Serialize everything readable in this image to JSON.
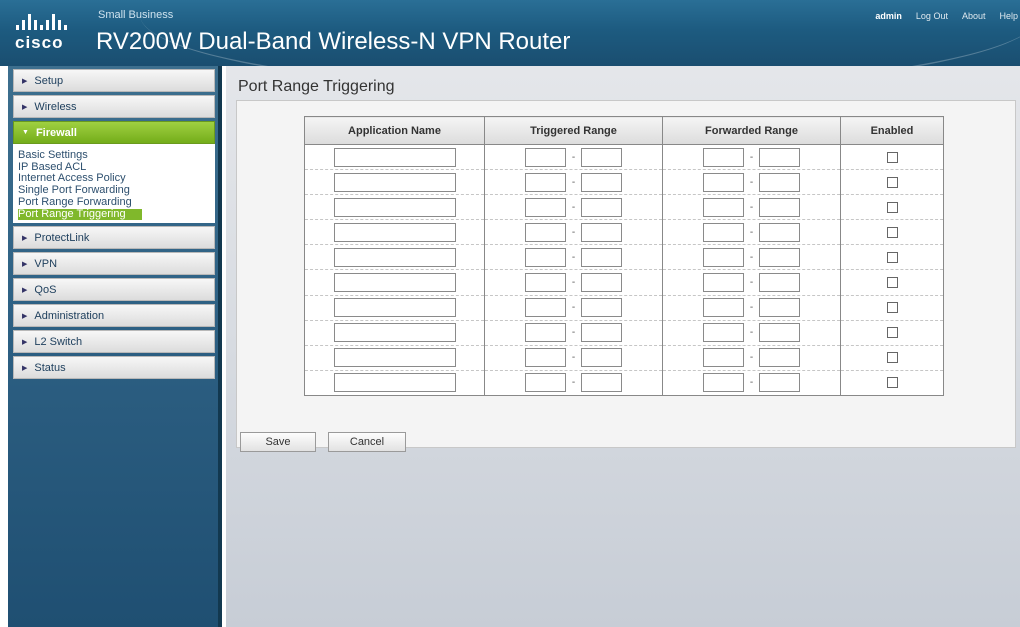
{
  "header": {
    "brand_small": "Small Business",
    "logo_word": "cisco",
    "product": "RV200W Dual-Band Wireless-N VPN Router",
    "links": {
      "user": "admin",
      "logout": "Log Out",
      "about": "About",
      "help": "Help"
    }
  },
  "nav": {
    "setup": "Setup",
    "wireless": "Wireless",
    "firewall": "Firewall",
    "firewall_sub": [
      "Basic Settings",
      "IP Based ACL",
      "Internet Access Policy",
      "Single Port Forwarding",
      "Port Range Forwarding",
      "Port Range Triggering"
    ],
    "protectlink": "ProtectLink",
    "vpn": "VPN",
    "qos": "QoS",
    "administration": "Administration",
    "l2switch": "L2 Switch",
    "status": "Status"
  },
  "page": {
    "title": "Port Range Triggering",
    "columns": {
      "app": "Application Name",
      "triggered": "Triggered Range",
      "forwarded": "Forwarded Range",
      "enabled": "Enabled"
    },
    "rows": [
      {
        "app": "",
        "trig_start": "",
        "trig_end": "",
        "fwd_start": "",
        "fwd_end": "",
        "enabled": false
      },
      {
        "app": "",
        "trig_start": "",
        "trig_end": "",
        "fwd_start": "",
        "fwd_end": "",
        "enabled": false
      },
      {
        "app": "",
        "trig_start": "",
        "trig_end": "",
        "fwd_start": "",
        "fwd_end": "",
        "enabled": false
      },
      {
        "app": "",
        "trig_start": "",
        "trig_end": "",
        "fwd_start": "",
        "fwd_end": "",
        "enabled": false
      },
      {
        "app": "",
        "trig_start": "",
        "trig_end": "",
        "fwd_start": "",
        "fwd_end": "",
        "enabled": false
      },
      {
        "app": "",
        "trig_start": "",
        "trig_end": "",
        "fwd_start": "",
        "fwd_end": "",
        "enabled": false
      },
      {
        "app": "",
        "trig_start": "",
        "trig_end": "",
        "fwd_start": "",
        "fwd_end": "",
        "enabled": false
      },
      {
        "app": "",
        "trig_start": "",
        "trig_end": "",
        "fwd_start": "",
        "fwd_end": "",
        "enabled": false
      },
      {
        "app": "",
        "trig_start": "",
        "trig_end": "",
        "fwd_start": "",
        "fwd_end": "",
        "enabled": false
      },
      {
        "app": "",
        "trig_start": "",
        "trig_end": "",
        "fwd_start": "",
        "fwd_end": "",
        "enabled": false
      }
    ],
    "range_separator": "-",
    "save_label": "Save",
    "cancel_label": "Cancel"
  },
  "colors": {
    "header": "#1d5b80",
    "active_nav": "#80b82b",
    "sidebar": "#2f6285"
  },
  "icons": {
    "nav_arrow": "right-arrow-icon",
    "logo": "cisco-logo-icon"
  }
}
